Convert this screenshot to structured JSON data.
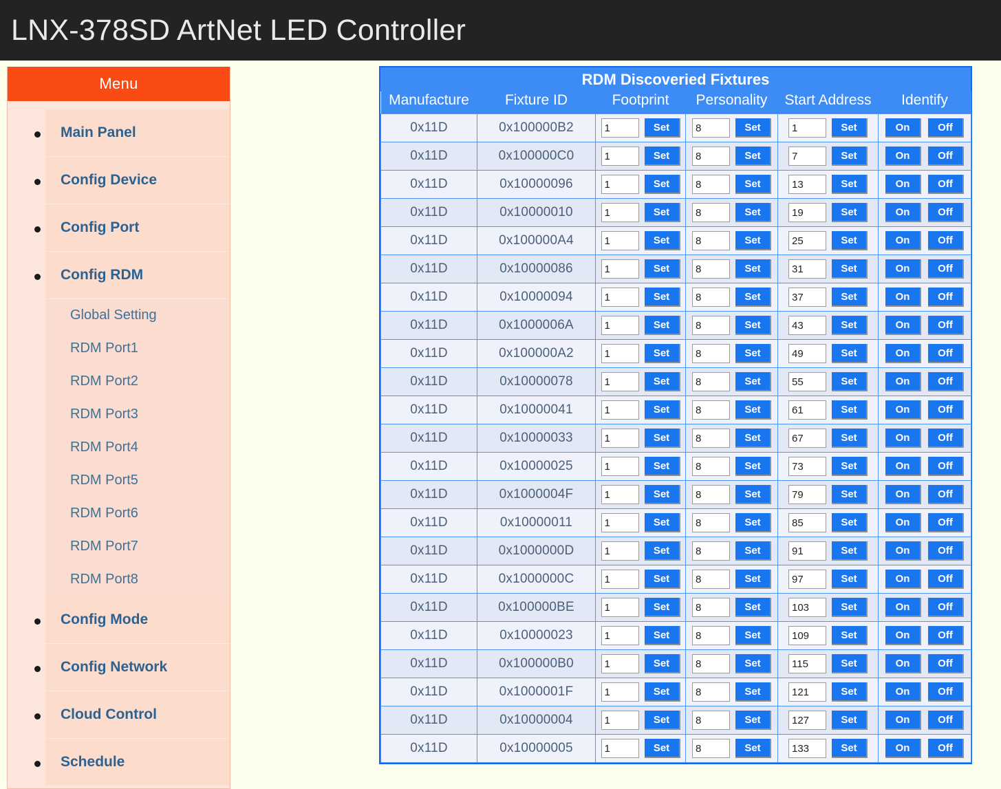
{
  "app": {
    "title": "LNX-378SD ArtNet LED Controller",
    "accent_orange": "#FA4B14",
    "accent_blue": "#3D8BF5",
    "background": "#FDFDEC"
  },
  "sidebar": {
    "header": "Menu",
    "items": [
      {
        "label": "Main Panel"
      },
      {
        "label": "Config Device"
      },
      {
        "label": "Config Port"
      },
      {
        "label": "Config RDM",
        "children": [
          {
            "label": "Global Setting"
          },
          {
            "label": "RDM Port1"
          },
          {
            "label": "RDM Port2"
          },
          {
            "label": "RDM Port3"
          },
          {
            "label": "RDM Port4"
          },
          {
            "label": "RDM Port5"
          },
          {
            "label": "RDM Port6"
          },
          {
            "label": "RDM Port7"
          },
          {
            "label": "RDM Port8"
          }
        ]
      },
      {
        "label": "Config Mode"
      },
      {
        "label": "Config Network"
      },
      {
        "label": "Cloud Control"
      },
      {
        "label": "Schedule"
      }
    ]
  },
  "rdm_table": {
    "title": "RDM Discoveried Fixtures",
    "columns": [
      "Manufacture",
      "Fixture ID",
      "Footprint",
      "Personality",
      "Start Address",
      "Identify"
    ],
    "buttons": {
      "set": "Set",
      "on": "On",
      "off": "Off"
    },
    "rows": [
      {
        "manufacture": "0x11D",
        "fixture_id": "0x100000B2",
        "footprint": "1",
        "personality": "8",
        "start_address": "1"
      },
      {
        "manufacture": "0x11D",
        "fixture_id": "0x100000C0",
        "footprint": "1",
        "personality": "8",
        "start_address": "7"
      },
      {
        "manufacture": "0x11D",
        "fixture_id": "0x10000096",
        "footprint": "1",
        "personality": "8",
        "start_address": "13"
      },
      {
        "manufacture": "0x11D",
        "fixture_id": "0x10000010",
        "footprint": "1",
        "personality": "8",
        "start_address": "19"
      },
      {
        "manufacture": "0x11D",
        "fixture_id": "0x100000A4",
        "footprint": "1",
        "personality": "8",
        "start_address": "25"
      },
      {
        "manufacture": "0x11D",
        "fixture_id": "0x10000086",
        "footprint": "1",
        "personality": "8",
        "start_address": "31"
      },
      {
        "manufacture": "0x11D",
        "fixture_id": "0x10000094",
        "footprint": "1",
        "personality": "8",
        "start_address": "37"
      },
      {
        "manufacture": "0x11D",
        "fixture_id": "0x1000006A",
        "footprint": "1",
        "personality": "8",
        "start_address": "43"
      },
      {
        "manufacture": "0x11D",
        "fixture_id": "0x100000A2",
        "footprint": "1",
        "personality": "8",
        "start_address": "49"
      },
      {
        "manufacture": "0x11D",
        "fixture_id": "0x10000078",
        "footprint": "1",
        "personality": "8",
        "start_address": "55"
      },
      {
        "manufacture": "0x11D",
        "fixture_id": "0x10000041",
        "footprint": "1",
        "personality": "8",
        "start_address": "61"
      },
      {
        "manufacture": "0x11D",
        "fixture_id": "0x10000033",
        "footprint": "1",
        "personality": "8",
        "start_address": "67"
      },
      {
        "manufacture": "0x11D",
        "fixture_id": "0x10000025",
        "footprint": "1",
        "personality": "8",
        "start_address": "73"
      },
      {
        "manufacture": "0x11D",
        "fixture_id": "0x1000004F",
        "footprint": "1",
        "personality": "8",
        "start_address": "79"
      },
      {
        "manufacture": "0x11D",
        "fixture_id": "0x10000011",
        "footprint": "1",
        "personality": "8",
        "start_address": "85"
      },
      {
        "manufacture": "0x11D",
        "fixture_id": "0x1000000D",
        "footprint": "1",
        "personality": "8",
        "start_address": "91"
      },
      {
        "manufacture": "0x11D",
        "fixture_id": "0x1000000C",
        "footprint": "1",
        "personality": "8",
        "start_address": "97"
      },
      {
        "manufacture": "0x11D",
        "fixture_id": "0x100000BE",
        "footprint": "1",
        "personality": "8",
        "start_address": "103"
      },
      {
        "manufacture": "0x11D",
        "fixture_id": "0x10000023",
        "footprint": "1",
        "personality": "8",
        "start_address": "109"
      },
      {
        "manufacture": "0x11D",
        "fixture_id": "0x100000B0",
        "footprint": "1",
        "personality": "8",
        "start_address": "115"
      },
      {
        "manufacture": "0x11D",
        "fixture_id": "0x1000001F",
        "footprint": "1",
        "personality": "8",
        "start_address": "121"
      },
      {
        "manufacture": "0x11D",
        "fixture_id": "0x10000004",
        "footprint": "1",
        "personality": "8",
        "start_address": "127"
      },
      {
        "manufacture": "0x11D",
        "fixture_id": "0x10000005",
        "footprint": "1",
        "personality": "8",
        "start_address": "133"
      }
    ]
  }
}
